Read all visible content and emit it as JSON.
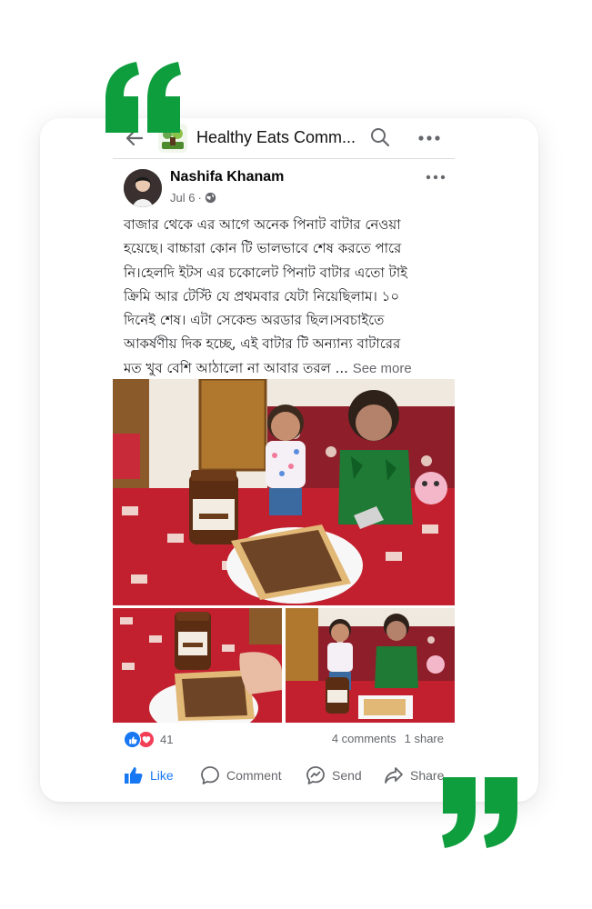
{
  "group": {
    "name": "Healthy Eats Comm..."
  },
  "post": {
    "author": "Nashifa Khanam",
    "date": "Jul 6",
    "meta_separator": "·",
    "text_lines": [
      "বাজার থেকে এর আগে অনেক পিনাট বাটার নেওয়া",
      "হয়েছে। বাচ্চারা কোন টি ভালভাবে শেষ করতে পারে",
      "নি।হেলদি ইটস এর চকোলেট পিনাট বাটার এতো টাই",
      "ক্রিমি আর টেস্টি যে প্রথমবার যেটা নিয়েছিলাম। ১০",
      "দিনেই শেষ। এটা সেকেন্ড অরডার ছিল।সবচাইতে",
      "আকর্ষণীয় দিক হচ্ছে, এই বাটার টি অন্যান্য বাটারের",
      "মত খুব বেশি আঠালো না আবার তরল ..."
    ],
    "see_more": "See more"
  },
  "reactions": {
    "count": "41",
    "types": [
      "like",
      "love"
    ]
  },
  "stats": {
    "comments": "4 comments",
    "shares": "1 share"
  },
  "actions": {
    "like": "Like",
    "comment": "Comment",
    "send": "Send",
    "share": "Share"
  },
  "colors": {
    "quote_green": "#0e9e3e",
    "facebook_blue": "#1877f2",
    "love_red": "#f33e58",
    "meta_gray": "#65676b"
  },
  "icons": [
    "quote-open-icon",
    "quote-close-icon",
    "back-arrow-icon",
    "search-icon",
    "more-icon",
    "globe-icon",
    "like-icon",
    "love-icon",
    "comment-icon",
    "send-icon",
    "share-icon"
  ]
}
